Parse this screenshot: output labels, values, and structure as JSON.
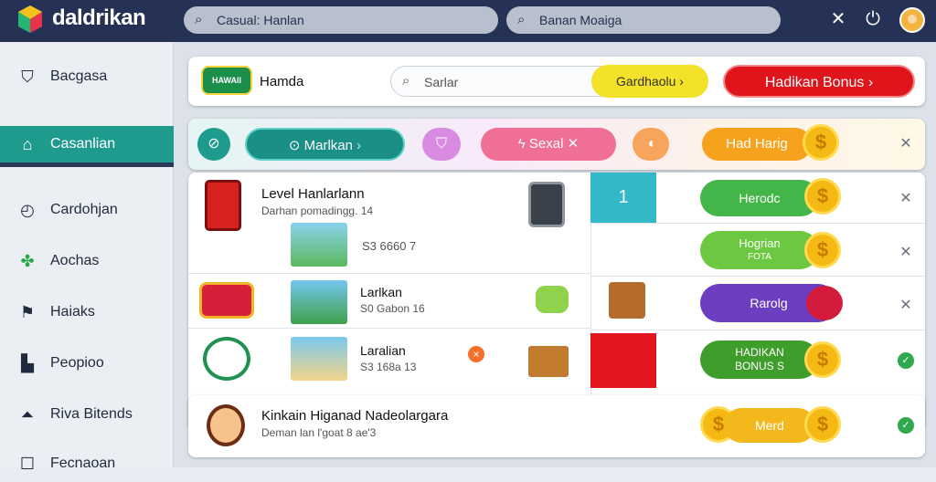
{
  "app": {
    "brand": "daldrikan"
  },
  "topbar": {
    "search1_placeholder": "Casual: Hanlan",
    "search2_placeholder": "Banan Moaiga"
  },
  "sidebar": {
    "items": [
      {
        "label": "Bacgasa",
        "icon": "shield-icon"
      },
      {
        "label": "Casanlian",
        "icon": "home-icon"
      },
      {
        "label": "Cardohjan",
        "icon": "clock-icon"
      },
      {
        "label": "Aochas",
        "icon": "clover-icon"
      },
      {
        "label": "Haiaks",
        "icon": "flag-icon"
      },
      {
        "label": "Peopioo",
        "icon": "bar-chart-icon"
      },
      {
        "label": "Riva Bitends",
        "icon": "bell-icon"
      },
      {
        "label": "Fecnaoan",
        "icon": "square-icon"
      }
    ]
  },
  "header": {
    "badge_text": "HAWAII",
    "title": "Hamda",
    "search_placeholder": "Sarlar",
    "yellow_button": "Gardhaolu",
    "red_button": "Hadikan Bonus"
  },
  "filters": {
    "teal_pill": "Marlkan",
    "pink_pill": "Sexal",
    "orange_pill": "Had Harig"
  },
  "rows": [
    {
      "title": "Level Hanlarlann",
      "subtitle": "Darhan pomadingg. 14",
      "code": "S3 6660 7"
    },
    {
      "title": "Larlkan",
      "subtitle": "S0 Gabon 16"
    },
    {
      "title": "Laralian",
      "subtitle": "S3 168a 13"
    }
  ],
  "right_panel": {
    "number": "1",
    "pill1": "Herodc",
    "pill2_line1": "Hogrian",
    "pill2_line2": "FOTA",
    "pill3": "Rarolg",
    "pill4_line1": "HADIKAN",
    "pill4_line2": "BONUS S"
  },
  "bottom_card": {
    "title": "Kinkain Higanad Nadeolargara",
    "subtitle": "Deman lan l'goat 8 ae'3",
    "pill": "Merd"
  },
  "colors": {
    "topbar": "#253256",
    "accent": "#1f9b8e",
    "red": "#e0151c",
    "green": "#44b649",
    "yellow": "#f4e12a"
  }
}
